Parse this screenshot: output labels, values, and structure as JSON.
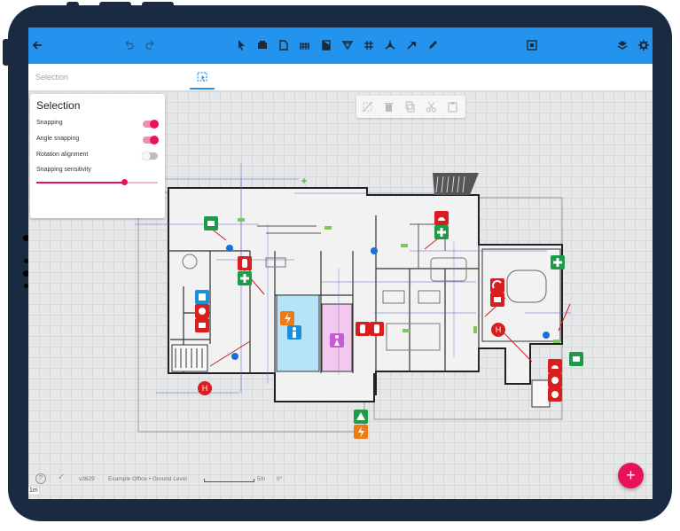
{
  "toolbar": {
    "icons": [
      "back-arrow-icon",
      "undo-icon",
      "redo-icon",
      "pointer-icon",
      "wall-icon",
      "room-icon",
      "stairs-icon",
      "door-icon",
      "funnel-icon",
      "grid-icon",
      "node-icon",
      "arrow-icon",
      "pencil-icon",
      "qr-icon",
      "layers-icon",
      "gear-icon"
    ]
  },
  "subbar": {
    "label": "Selection"
  },
  "panel": {
    "title": "Selection",
    "rows": [
      {
        "label": "Snapping",
        "on": true
      },
      {
        "label": "Angle snapping",
        "on": true
      },
      {
        "label": "Rotation alignment",
        "on": false
      }
    ],
    "slider_label": "Snapping sensitivity",
    "slider_value": 0.72
  },
  "status": {
    "version": "v3629",
    "project": "Example Office • Ground Level",
    "scale": "5m",
    "angle": "0°",
    "corner_scale": "1m"
  },
  "colors": {
    "topbar": "#2493ee",
    "accent": "#e8125c",
    "frame": "#1a2a40",
    "fire_red": "#d81e1e",
    "safety_green": "#1f9a48",
    "hazard_orange": "#f07a12",
    "info_blue": "#1a8fdc"
  }
}
